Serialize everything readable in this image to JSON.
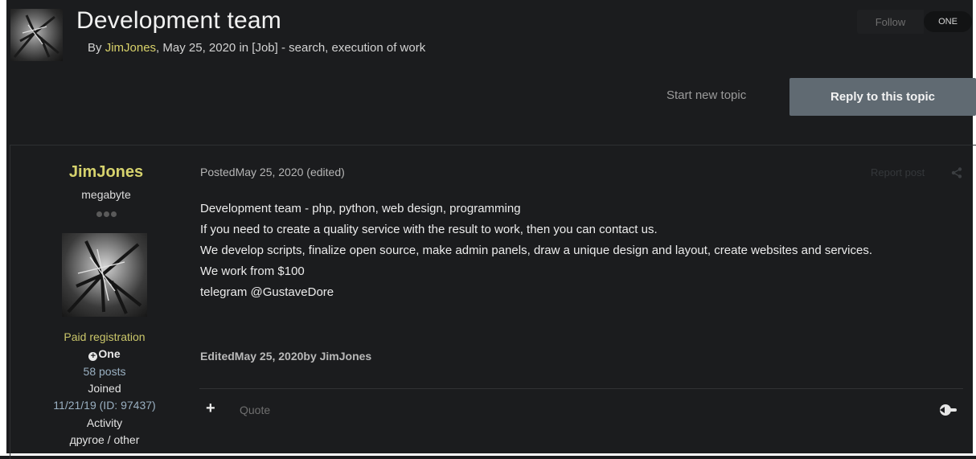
{
  "topic": {
    "title": "Development team",
    "meta_by": "By ",
    "author": "JimJones",
    "meta_rest": ", May 25, 2020 in [Job] - search, execution of work",
    "follow_label": "Follow",
    "follow_count": "ONE"
  },
  "actions": {
    "start_new_topic": "Start new topic",
    "reply": "Reply to this topic"
  },
  "post": {
    "author": {
      "name": "JimJones",
      "rank": "megabyte",
      "group": "Paid registration",
      "badge": "One",
      "posts": "58 posts",
      "joined_label": "Joined",
      "joined_value": "11/21/19 (ID: 97437)",
      "activity_label": "Activity",
      "activity_value": "другое / other"
    },
    "posted": "PostedMay 25, 2020 (edited)",
    "report": "Report post",
    "body": [
      "Development team - php, python, web design, programming",
      "If you need to create a quality service with the result to work, then you can contact us.",
      "We develop scripts, finalize open source, make admin panels, draw a unique design and layout, create websites and services.",
      "We work from $100",
      "telegram @GustaveDore"
    ],
    "edited": "EditedMay 25, 2020by JimJones",
    "plus": "+",
    "quote": "Quote"
  },
  "icons": {
    "share": "share-icon",
    "reaction": "reaction-icon",
    "badge": "plus-circle-icon"
  },
  "colors": {
    "background": "#1b1c1e",
    "accent": "#d6d26d",
    "reply_button": "#606a72",
    "link": "#9ab0c2"
  }
}
